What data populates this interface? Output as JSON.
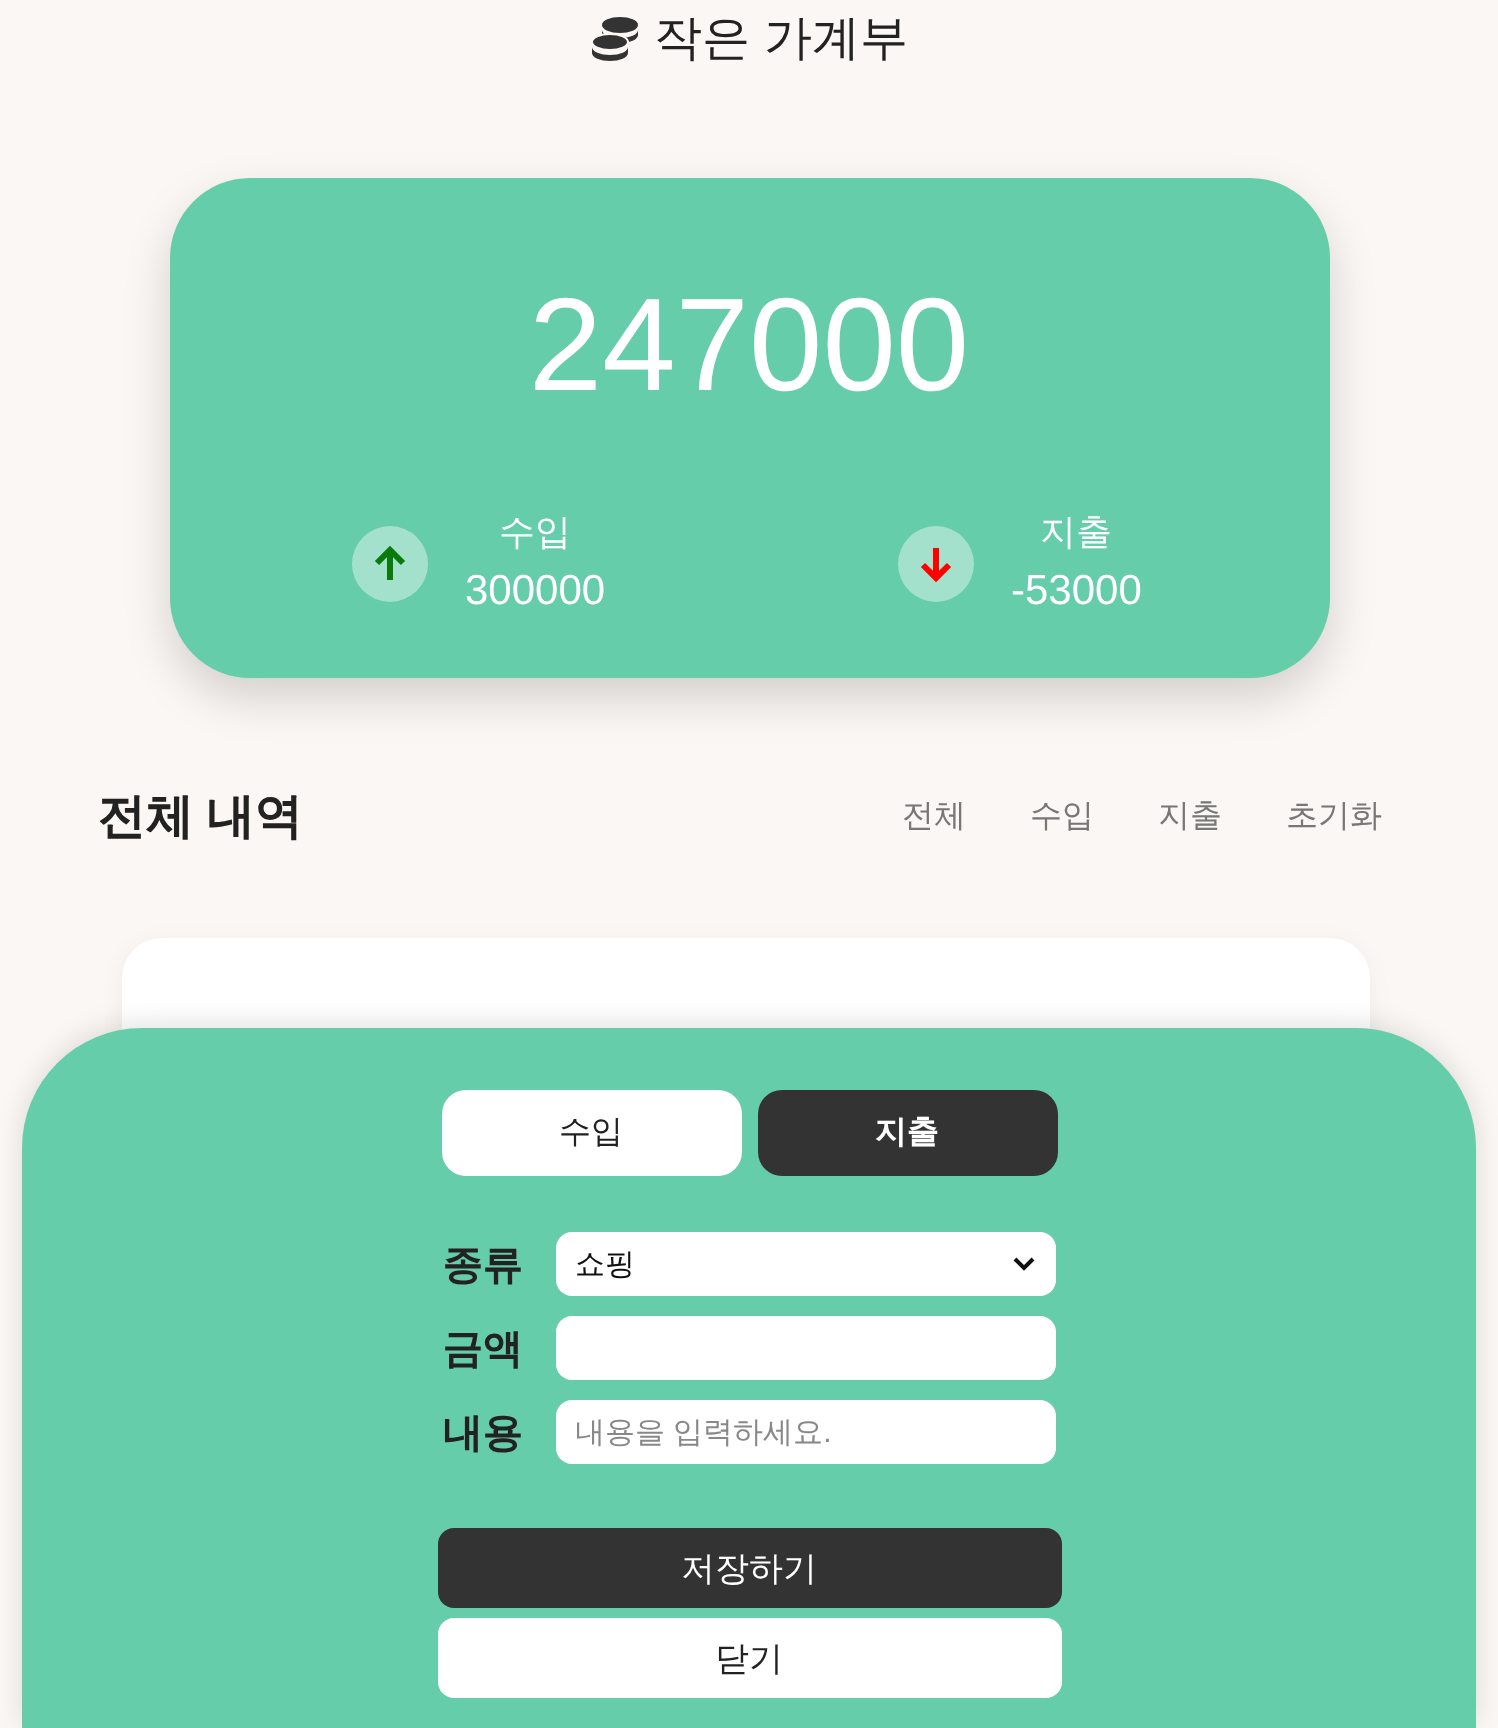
{
  "header": {
    "title": "작은 가계부"
  },
  "summary": {
    "balance": "247000",
    "stats": [
      {
        "kind": "income",
        "label": "수입",
        "amount": "300000"
      },
      {
        "kind": "expense",
        "label": "지출",
        "amount": "-53000"
      }
    ]
  },
  "history": {
    "title": "전체 내역",
    "filters": [
      "전체",
      "수입",
      "지출",
      "초기화"
    ]
  },
  "sheet": {
    "tabs": [
      {
        "label": "수입",
        "selected": false
      },
      {
        "label": "지출",
        "selected": true
      }
    ],
    "fields": [
      {
        "kind": "select",
        "label": "종류",
        "value": "쇼핑"
      },
      {
        "kind": "input",
        "label": "금액"
      },
      {
        "kind": "input",
        "label": "내용",
        "placeholder": "내용을 입력하세요."
      }
    ],
    "buttons": [
      {
        "kind": "primary",
        "label": "저장하기"
      },
      {
        "kind": "secondary",
        "label": "닫기"
      }
    ]
  }
}
